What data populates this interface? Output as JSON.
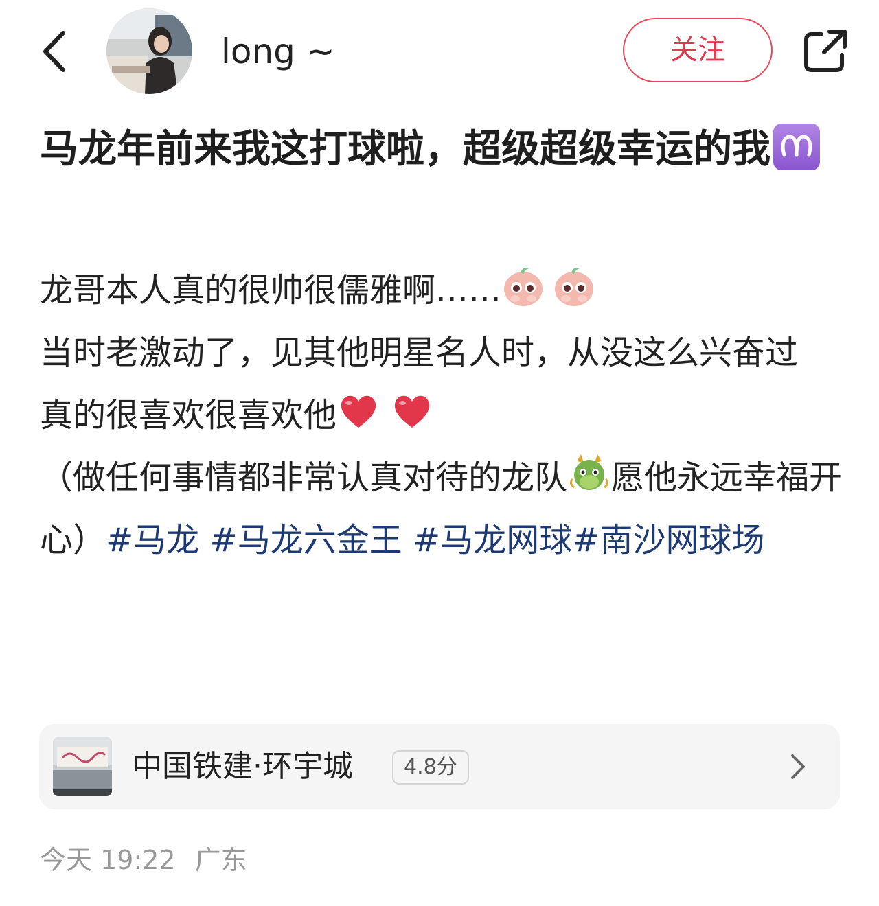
{
  "header": {
    "back_icon": "chevron-left-icon",
    "username": "long ~",
    "follow_label": "关注",
    "share_icon": "share-external-icon"
  },
  "post": {
    "title": "马龙年前来我这打球啦，超级超级幸运的我",
    "title_emoji": "aries-icon",
    "lines": [
      "龙哥本人真的很帅很儒雅啊……",
      "当时老激动了，见其他明星名人时，从没这么兴奋过",
      "真的很喜欢很喜欢他",
      "（做任何事情都非常认真对待的龙队",
      "愿他永远幸福开心）"
    ],
    "emojis": {
      "line1": [
        "pleading-peach-emoji",
        "pleading-peach-emoji"
      ],
      "line3": [
        "red-heart-emoji",
        "red-heart-emoji"
      ],
      "line4": "dragon-face-emoji"
    },
    "hashtags": [
      "#马龙",
      "#马龙六金王",
      "#马龙网球#",
      "南沙网球场"
    ]
  },
  "location": {
    "name": "中国铁建·环宇城",
    "rating": "4.8分"
  },
  "meta": {
    "date": "今天 19:22",
    "region": "广东"
  },
  "colors": {
    "accent_red": "#e23a4d",
    "hashtag_blue": "#1d3a73",
    "muted_text": "#999999",
    "card_bg": "#f5f5f5"
  }
}
